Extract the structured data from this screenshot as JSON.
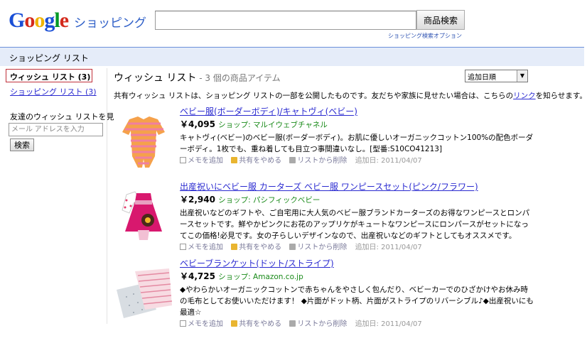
{
  "header": {
    "logo_letters": [
      "G",
      "o",
      "o",
      "g",
      "l",
      "e"
    ],
    "logo_sub": "ショッピング",
    "search_value": "",
    "search_button": "商品検索",
    "search_options": "ショッピング検索オプション"
  },
  "bar": {
    "title": "ショッピング リスト"
  },
  "sidebar": {
    "active": "ウィッシュ リスト (3)",
    "link": "ショッピング リスト (3)",
    "friend_label": "友達のウィッシュ リストを見る",
    "friend_placeholder": "メール アドレスを入力",
    "friend_button": "検索"
  },
  "main": {
    "title": "ウィッシュ リスト",
    "count": " - 3 個の商品アイテム",
    "sort_value": "追加日順",
    "share_desc_pre": "共有ウィッシュ リストは、ショッピング リストの一部を公開したものです。友だちや家族に見せたい場合は、こちらの",
    "share_link": "リンク",
    "share_desc_post": "を知らせます。"
  },
  "actions": {
    "memo": "メモを追加",
    "share": "共有をやめる",
    "delete": "リストから削除"
  },
  "items": [
    {
      "title": "ベビー服(ボーダーボディ)/キャトヴィ(ベビー)",
      "price": "￥4,095",
      "shop": "ショップ: マルイウェブチャネル",
      "desc": "キャトヴィ(ベビー)のベビー服(ボーダーボディ)。お肌に優しいオーガニックコットン100%の配色ボーダーボディ。1枚でも、重ね着しても目立つ事間違いなし。[型番:S10CO41213]",
      "added": "追加日: 2011/04/07"
    },
    {
      "title": "出産祝いにベビー服 カーターズ ベビー服 ワンピースセット(ピンク/フラワー)",
      "price": "￥2,940",
      "shop": "ショップ: パシフィックベビー",
      "desc": "出産祝いなどのギフトや、ご自宅用に大人気のベビー服ブランドカーターズのお得なワンピースとロンパースセットです。鮮やかピンクにお花のアップリケがキュートなワンピースにロンパースがセットになってこの価格!必見です。女の子らしいデザインなので、出産祝いなどのギフトとしてもオススメです。",
      "added": "追加日: 2011/04/07"
    },
    {
      "title": "ベビーブランケット(ドット/ストライプ)",
      "price": "￥4,725",
      "shop": "ショップ: Amazon.co.jp",
      "desc": "◆やわらかいオーガニックコットンで赤ちゃんをやさしく包んだり、ベビーカーでのひざかけやお休み時の毛布としてお使いいただけます！ ◆片面がドット柄、片面がストライプのリバーシブル♪◆出産祝いにも最適☆",
      "added": "追加日: 2011/04/07"
    }
  ]
}
